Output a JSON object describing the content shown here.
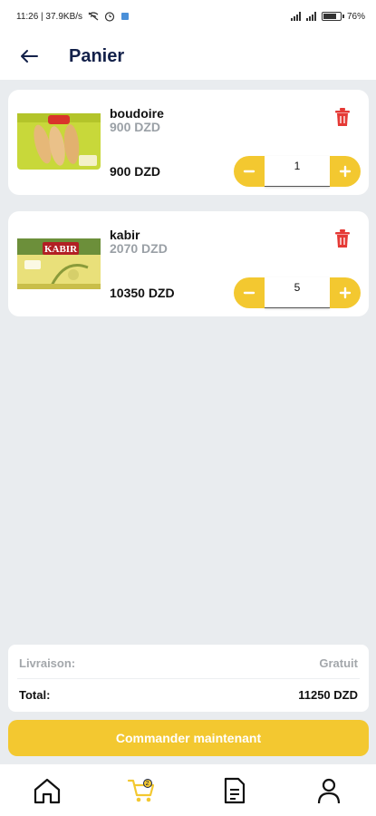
{
  "status_bar": {
    "time_info": "11:26 | 37.9KB/s",
    "battery": "76",
    "battery_level": 0.76
  },
  "header": {
    "title": "Panier"
  },
  "cart": {
    "items": [
      {
        "name": "boudoire",
        "unit_price": "900 DZD",
        "total": "900 DZD",
        "quantity": "1",
        "image_icon": "biscuit-pack-image"
      },
      {
        "name": "kabir",
        "unit_price": "2070 DZD",
        "total": "10350 DZD",
        "quantity": "5",
        "image_icon": "kabir-box-image",
        "image_label": "KABIR"
      }
    ]
  },
  "summary": {
    "delivery_label": "Livraison:",
    "delivery_value": "Gratuit",
    "total_label": "Total:",
    "total_value": "11250 DZD"
  },
  "order_button": {
    "label": "Commander maintenant"
  },
  "bottom_nav": {
    "cart_count": "2",
    "items": [
      "home-icon",
      "cart-icon",
      "orders-icon",
      "profile-icon"
    ]
  },
  "colors": {
    "accent": "#f3c830",
    "title": "#13214a",
    "delete": "#e53935",
    "background": "#e9ecef"
  }
}
